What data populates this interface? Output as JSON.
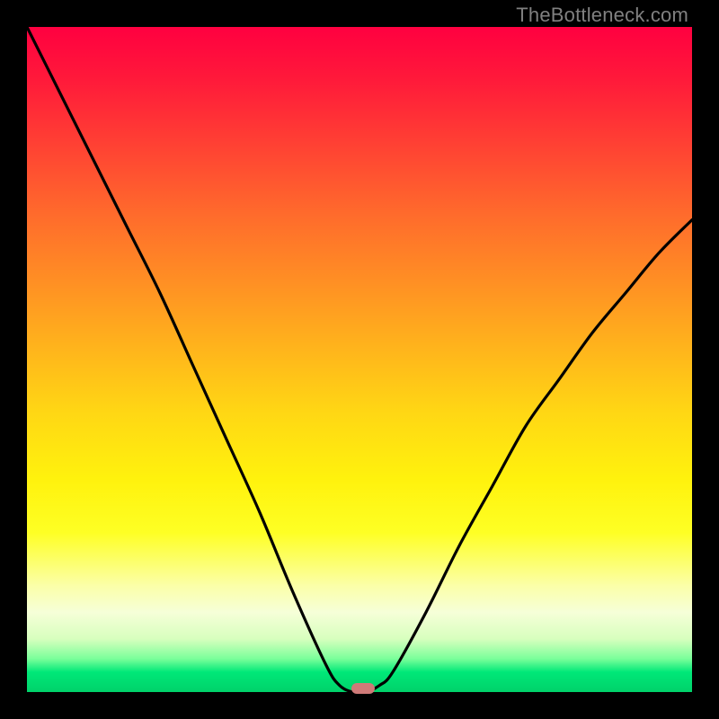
{
  "watermark": "TheBottleneck.com",
  "chart_data": {
    "type": "line",
    "title": "",
    "xlabel": "",
    "ylabel": "",
    "xlim": [
      0,
      1
    ],
    "ylim": [
      0,
      1
    ],
    "x": [
      0.0,
      0.05,
      0.1,
      0.15,
      0.2,
      0.25,
      0.3,
      0.35,
      0.4,
      0.45,
      0.47,
      0.49,
      0.51,
      0.53,
      0.55,
      0.6,
      0.65,
      0.7,
      0.75,
      0.8,
      0.85,
      0.9,
      0.95,
      1.0
    ],
    "values": [
      1.0,
      0.9,
      0.8,
      0.7,
      0.6,
      0.49,
      0.38,
      0.27,
      0.15,
      0.04,
      0.01,
      0.0,
      0.0,
      0.01,
      0.03,
      0.12,
      0.22,
      0.31,
      0.4,
      0.47,
      0.54,
      0.6,
      0.66,
      0.71
    ],
    "marker": {
      "x": 0.505,
      "y": 0.0
    },
    "background_gradient": {
      "top": "#ff0040",
      "mid": "#fff20d",
      "bottom": "#00d26a"
    }
  },
  "colors": {
    "curve": "#000000",
    "border": "#000000",
    "marker": "#cf7a78",
    "watermark": "#808080"
  }
}
